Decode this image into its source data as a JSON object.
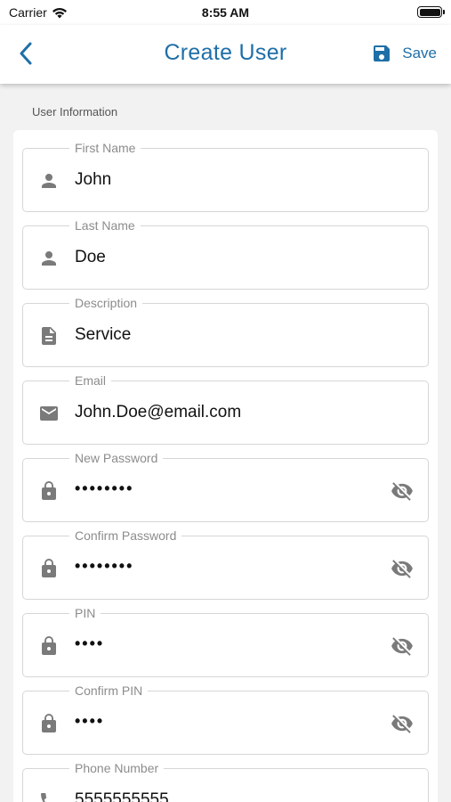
{
  "status_bar": {
    "carrier": "Carrier",
    "time": "8:55 AM"
  },
  "app_bar": {
    "title": "Create User",
    "save_label": "Save"
  },
  "section": {
    "title": "User Information"
  },
  "fields": [
    {
      "label": "First Name",
      "value": "John",
      "icon": "person-icon"
    },
    {
      "label": "Last Name",
      "value": "Doe",
      "icon": "person-icon"
    },
    {
      "label": "Description",
      "value": "Service",
      "icon": "document-icon"
    },
    {
      "label": "Email",
      "value": "John.Doe@email.com",
      "icon": "mail-icon"
    },
    {
      "label": "New Password",
      "value": "••••••••",
      "icon": "lock-icon"
    },
    {
      "label": "Confirm Password",
      "value": "••••••••",
      "icon": "lock-icon"
    },
    {
      "label": "PIN",
      "value": "••••",
      "icon": "lock-icon"
    },
    {
      "label": "Confirm PIN",
      "value": "••••",
      "icon": "lock-icon"
    },
    {
      "label": "Phone Number",
      "value": "5555555555",
      "icon": "phone-icon"
    }
  ],
  "colors": {
    "accent": "#1e6fa8",
    "icon_gray": "#7a7a7a"
  }
}
